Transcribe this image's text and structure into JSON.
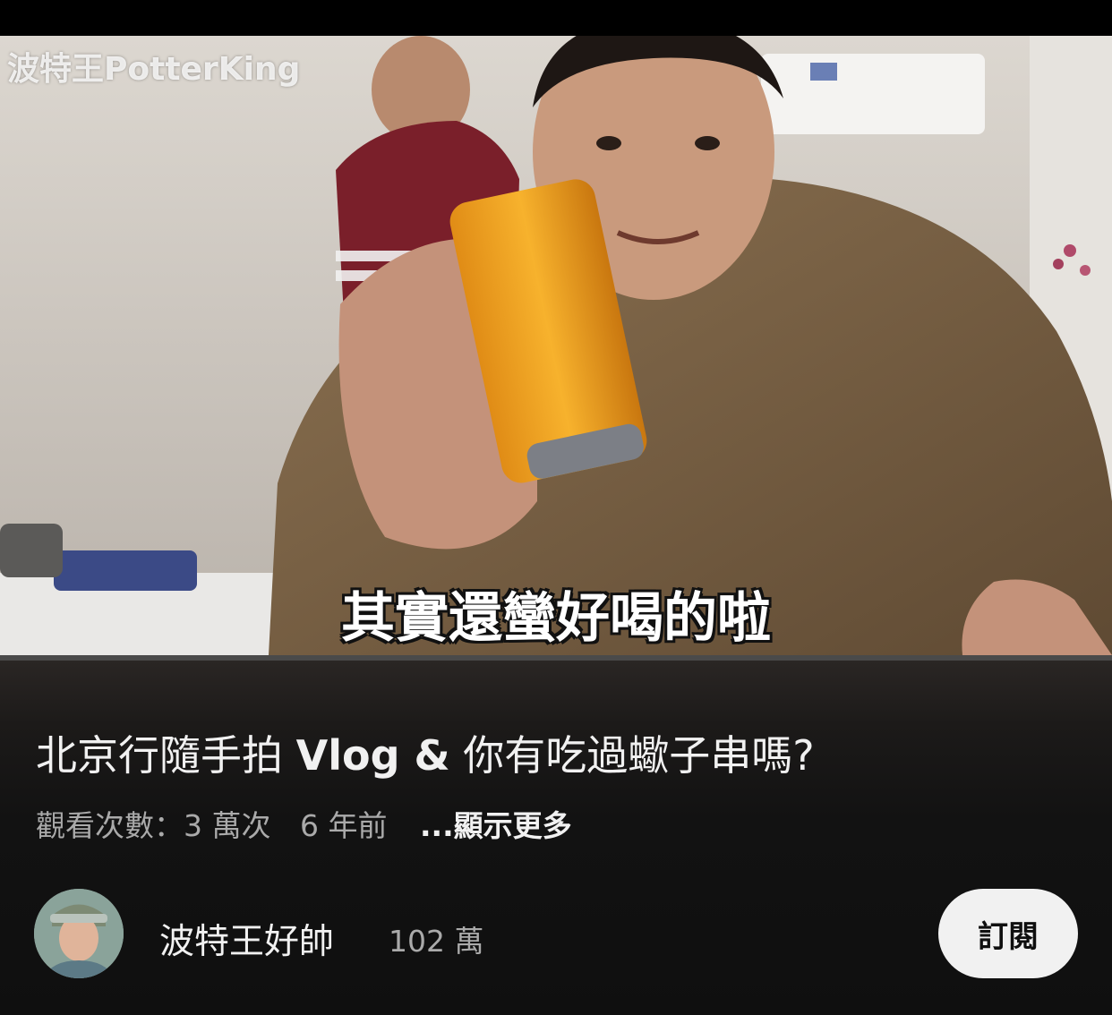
{
  "video": {
    "watermark": "波特王PotterKing",
    "subtitle": "其實還蠻好喝的啦",
    "progress_fraction": 0.0
  },
  "info": {
    "title_part1": "北京行隨手拍 ",
    "title_strong": "Vlog &",
    "title_part2": " 你有吃過蠍子串嗎?",
    "views": "觀看次數：3 萬次",
    "age": "6 年前",
    "show_more": "...顯示更多"
  },
  "channel": {
    "name": "波特王好帥",
    "subscribers": "102 萬",
    "subscribe_label": "訂閱"
  },
  "colors": {
    "background": "#0f0f0f",
    "progress": "#ff0000",
    "subscribe_bg": "#f1f1f1"
  }
}
